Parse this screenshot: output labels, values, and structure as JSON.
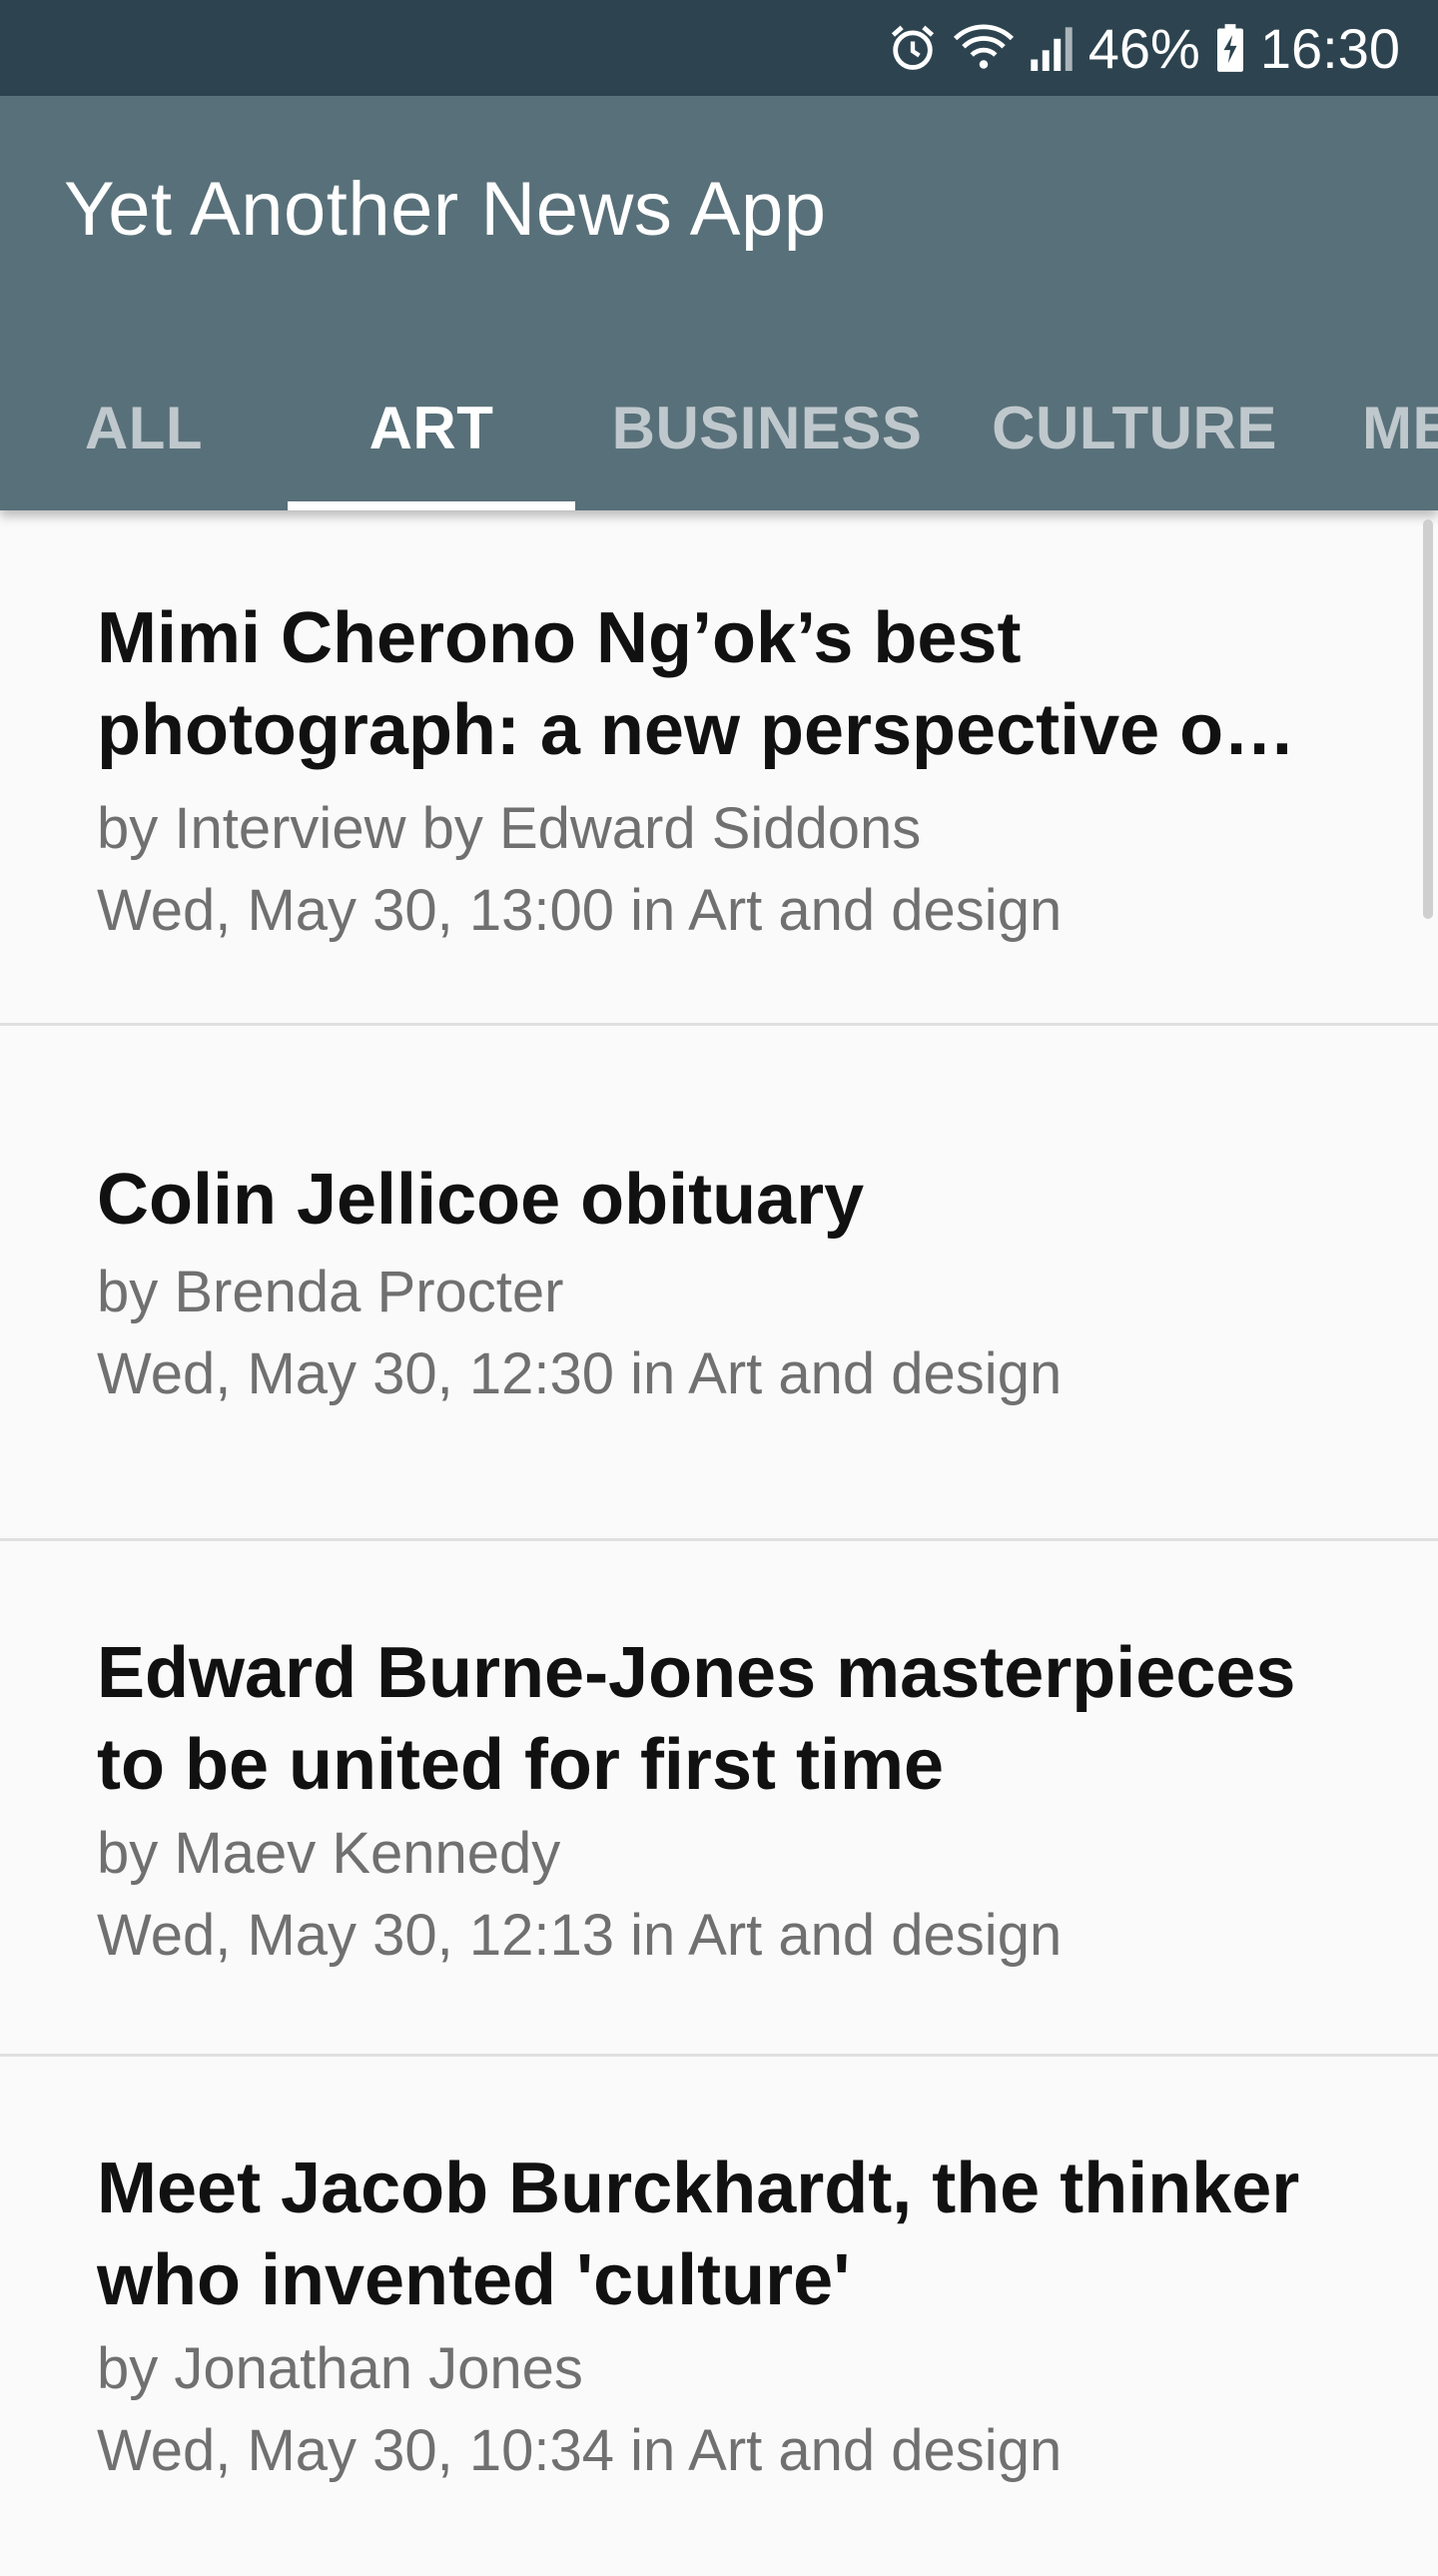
{
  "status_bar": {
    "battery_percent": "46%",
    "time": "16:30",
    "icons": [
      "alarm-icon",
      "wifi-icon",
      "signal-icon",
      "battery-icon"
    ]
  },
  "app": {
    "title": "Yet Another News App"
  },
  "tabs": [
    {
      "label": "ALL"
    },
    {
      "label": "ART"
    },
    {
      "label": "BUSINESS"
    },
    {
      "label": "CULTURE"
    },
    {
      "label": "ME"
    }
  ],
  "active_tab": "ART",
  "articles": [
    {
      "title": "Mimi Cherono Ng’ok’s best photograph: a new perspective o…",
      "byline": "by Interview by Edward Siddons",
      "dateline": "Wed, May 30, 13:00 in Art and design"
    },
    {
      "title": "Colin Jellicoe obituary",
      "byline": "by Brenda Procter",
      "dateline": "Wed, May 30, 12:30 in Art and design"
    },
    {
      "title": "Edward Burne-Jones masterpieces to be united for first time",
      "byline": "by Maev Kennedy",
      "dateline": "Wed, May 30, 12:13 in Art and design"
    },
    {
      "title": "Meet Jacob Burckhardt, the thinker who invented 'culture'",
      "byline": "by Jonathan Jones",
      "dateline": "Wed, May 30, 10:34 in Art and design"
    }
  ],
  "colors": {
    "status_bar": "#2d4450",
    "app_bar": "#587079",
    "background": "#fafafa",
    "title_text": "#111111",
    "meta_text": "#707070"
  }
}
